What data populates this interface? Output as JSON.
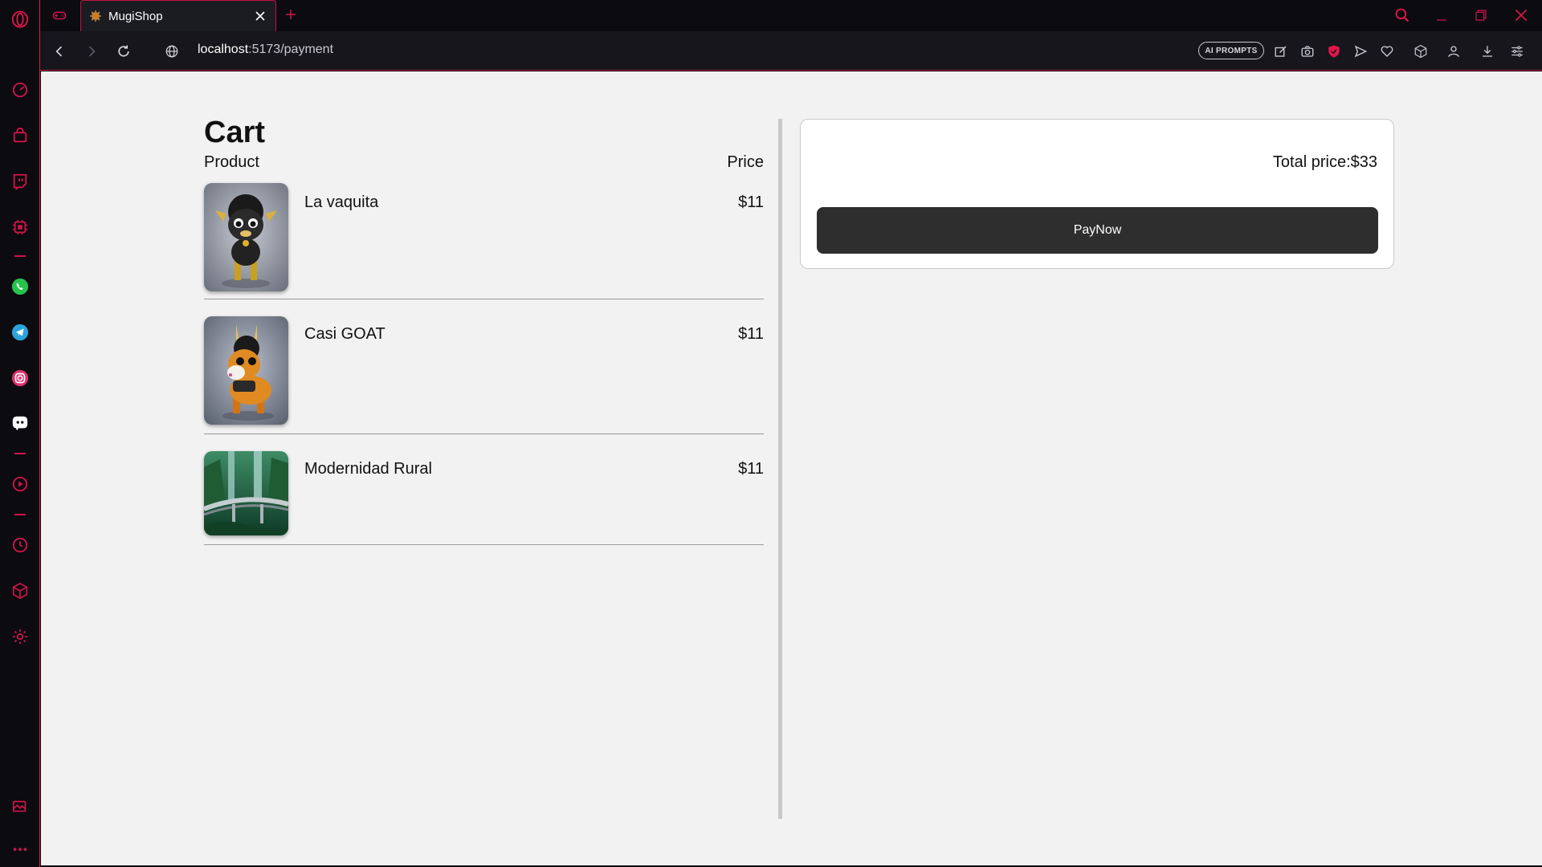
{
  "browser": {
    "tab_title": "MugiShop",
    "url_host": "localhost",
    "url_path": ":5173/payment",
    "ai_badge": "AI PROMPTS",
    "accent_color": "#e0164a"
  },
  "sidebar": {
    "icons": [
      "opera-logo-icon",
      "speed-dial-icon",
      "shopping-bag-icon",
      "twitch-icon",
      "gx-control-icon",
      "whatsapp-icon",
      "telegram-icon",
      "instagram-icon",
      "discord-icon",
      "player-icon",
      "history-icon",
      "extensions-icon",
      "settings-icon",
      "wallpaper-icon",
      "more-icon"
    ]
  },
  "cart": {
    "title": "Cart",
    "col_product": "Product",
    "col_price": "Price",
    "items": [
      {
        "name": "La vaquita",
        "price": "$11"
      },
      {
        "name": "Casi GOAT",
        "price": "$11"
      },
      {
        "name": "Modernidad Rural",
        "price": "$11"
      }
    ]
  },
  "summary": {
    "total_label": "Total price:$33",
    "pay_button": "PayNow"
  }
}
